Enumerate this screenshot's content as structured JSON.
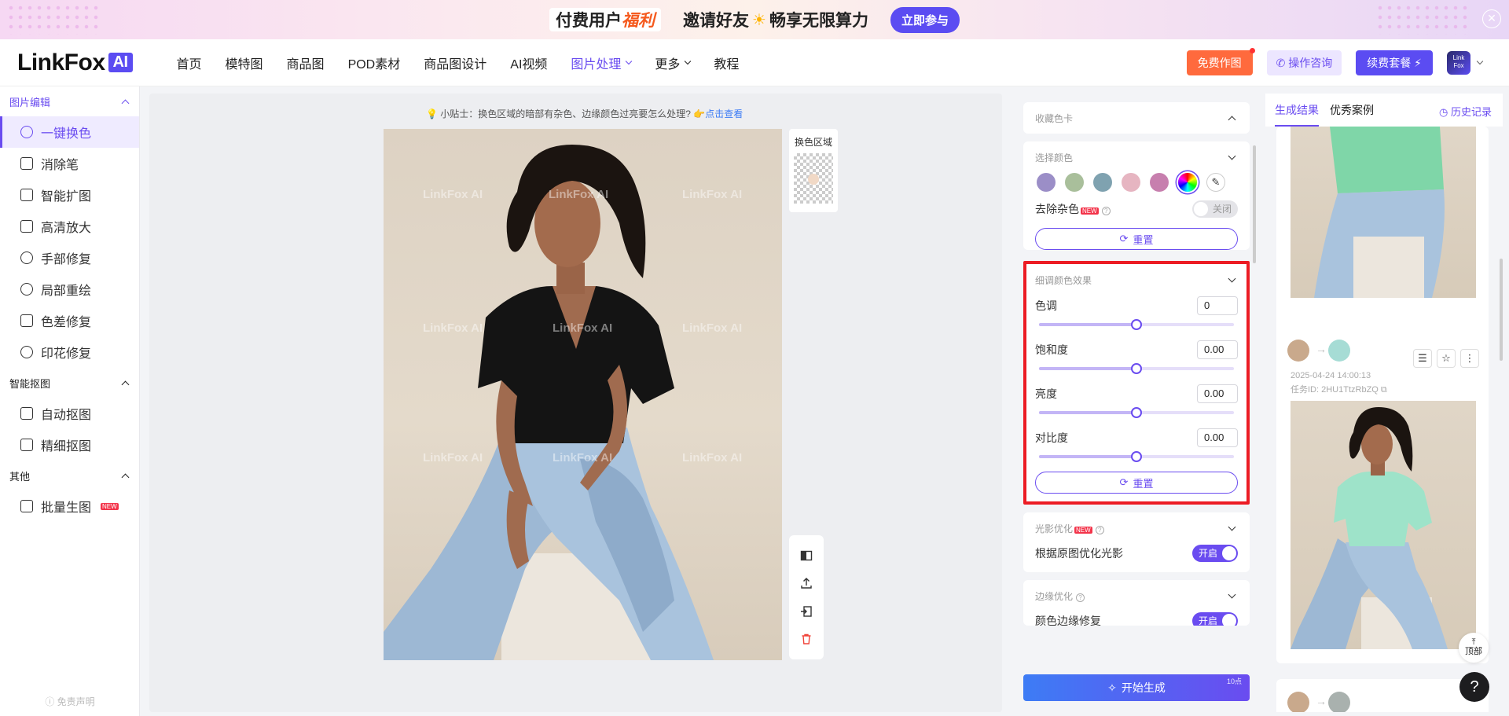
{
  "promo": {
    "paid_prefix": "付费用户",
    "paid_highlight": "福利",
    "invite_left": "邀请好友",
    "invite_right": "畅享无限算力",
    "join_label": "立即参与"
  },
  "header": {
    "logo_text": "LinkFox",
    "logo_ai": "AI",
    "nav": [
      {
        "label": "首页"
      },
      {
        "label": "模特图"
      },
      {
        "label": "商品图"
      },
      {
        "label": "POD素材"
      },
      {
        "label": "商品图设计"
      },
      {
        "label": "AI视频"
      },
      {
        "label": "图片处理"
      },
      {
        "label": "更多"
      },
      {
        "label": "教程"
      }
    ],
    "free_label": "免费作图",
    "consult_label": "操作咨询",
    "renew_label": "续费套餐 ⚡",
    "avatar_text": "Link Fox"
  },
  "sidebar": {
    "group_edit": "图片编辑",
    "edit_items": [
      {
        "label": "一键换色"
      },
      {
        "label": "消除笔"
      },
      {
        "label": "智能扩图"
      },
      {
        "label": "高清放大"
      },
      {
        "label": "手部修复"
      },
      {
        "label": "局部重绘"
      },
      {
        "label": "色差修复"
      },
      {
        "label": "印花修复"
      }
    ],
    "group_cutout": "智能抠图",
    "cutout_items": [
      {
        "label": "自动抠图"
      },
      {
        "label": "精细抠图"
      }
    ],
    "group_other": "其他",
    "other_items": [
      {
        "label": "批量生图",
        "badge": "NEW"
      }
    ],
    "footer": "免责声明"
  },
  "canvas": {
    "tip_text": "小贴士：换色区域的暗部有杂色、边缘颜色过亮要怎么处理?",
    "tip_link": "点击查看",
    "watermark": "LinkFox AI",
    "area_label": "换色区域"
  },
  "panel": {
    "collect_title": "收藏色卡",
    "select_title": "选择颜色",
    "swatch_colors": [
      "#9b8ec7",
      "#a9bf9b",
      "#7fa2b0",
      "#e6b5c1",
      "#c77fae"
    ],
    "remove_noise_label": "去除杂色",
    "remove_noise_badge": "NEW",
    "remove_noise_state": "关闭",
    "reset_label": "重置",
    "fine_title": "细调颜色效果",
    "adjust": [
      {
        "label": "色调",
        "value": "0",
        "level": 0.5
      },
      {
        "label": "饱和度",
        "value": "0.00",
        "level": 0.5
      },
      {
        "label": "亮度",
        "value": "0.00",
        "level": 0.5
      },
      {
        "label": "对比度",
        "value": "0.00",
        "level": 0.5
      }
    ],
    "light_title": "光影优化",
    "light_badge": "NEW",
    "light_label": "根据原图优化光影",
    "light_state": "开启",
    "edge_title": "边缘优化",
    "edge_label": "颜色边缘修复",
    "edge_state": "开启",
    "generate_label": "开始生成",
    "generate_cost": "10点"
  },
  "results": {
    "tab_results": "生成结果",
    "tab_cases": "优秀案例",
    "history_label": "历史记录",
    "card2_date": "2025-04-24 14:00:13",
    "card2_task": "任务ID: 2HU1TtzRbZQ",
    "top_label": "顶部",
    "help_label": "?"
  }
}
